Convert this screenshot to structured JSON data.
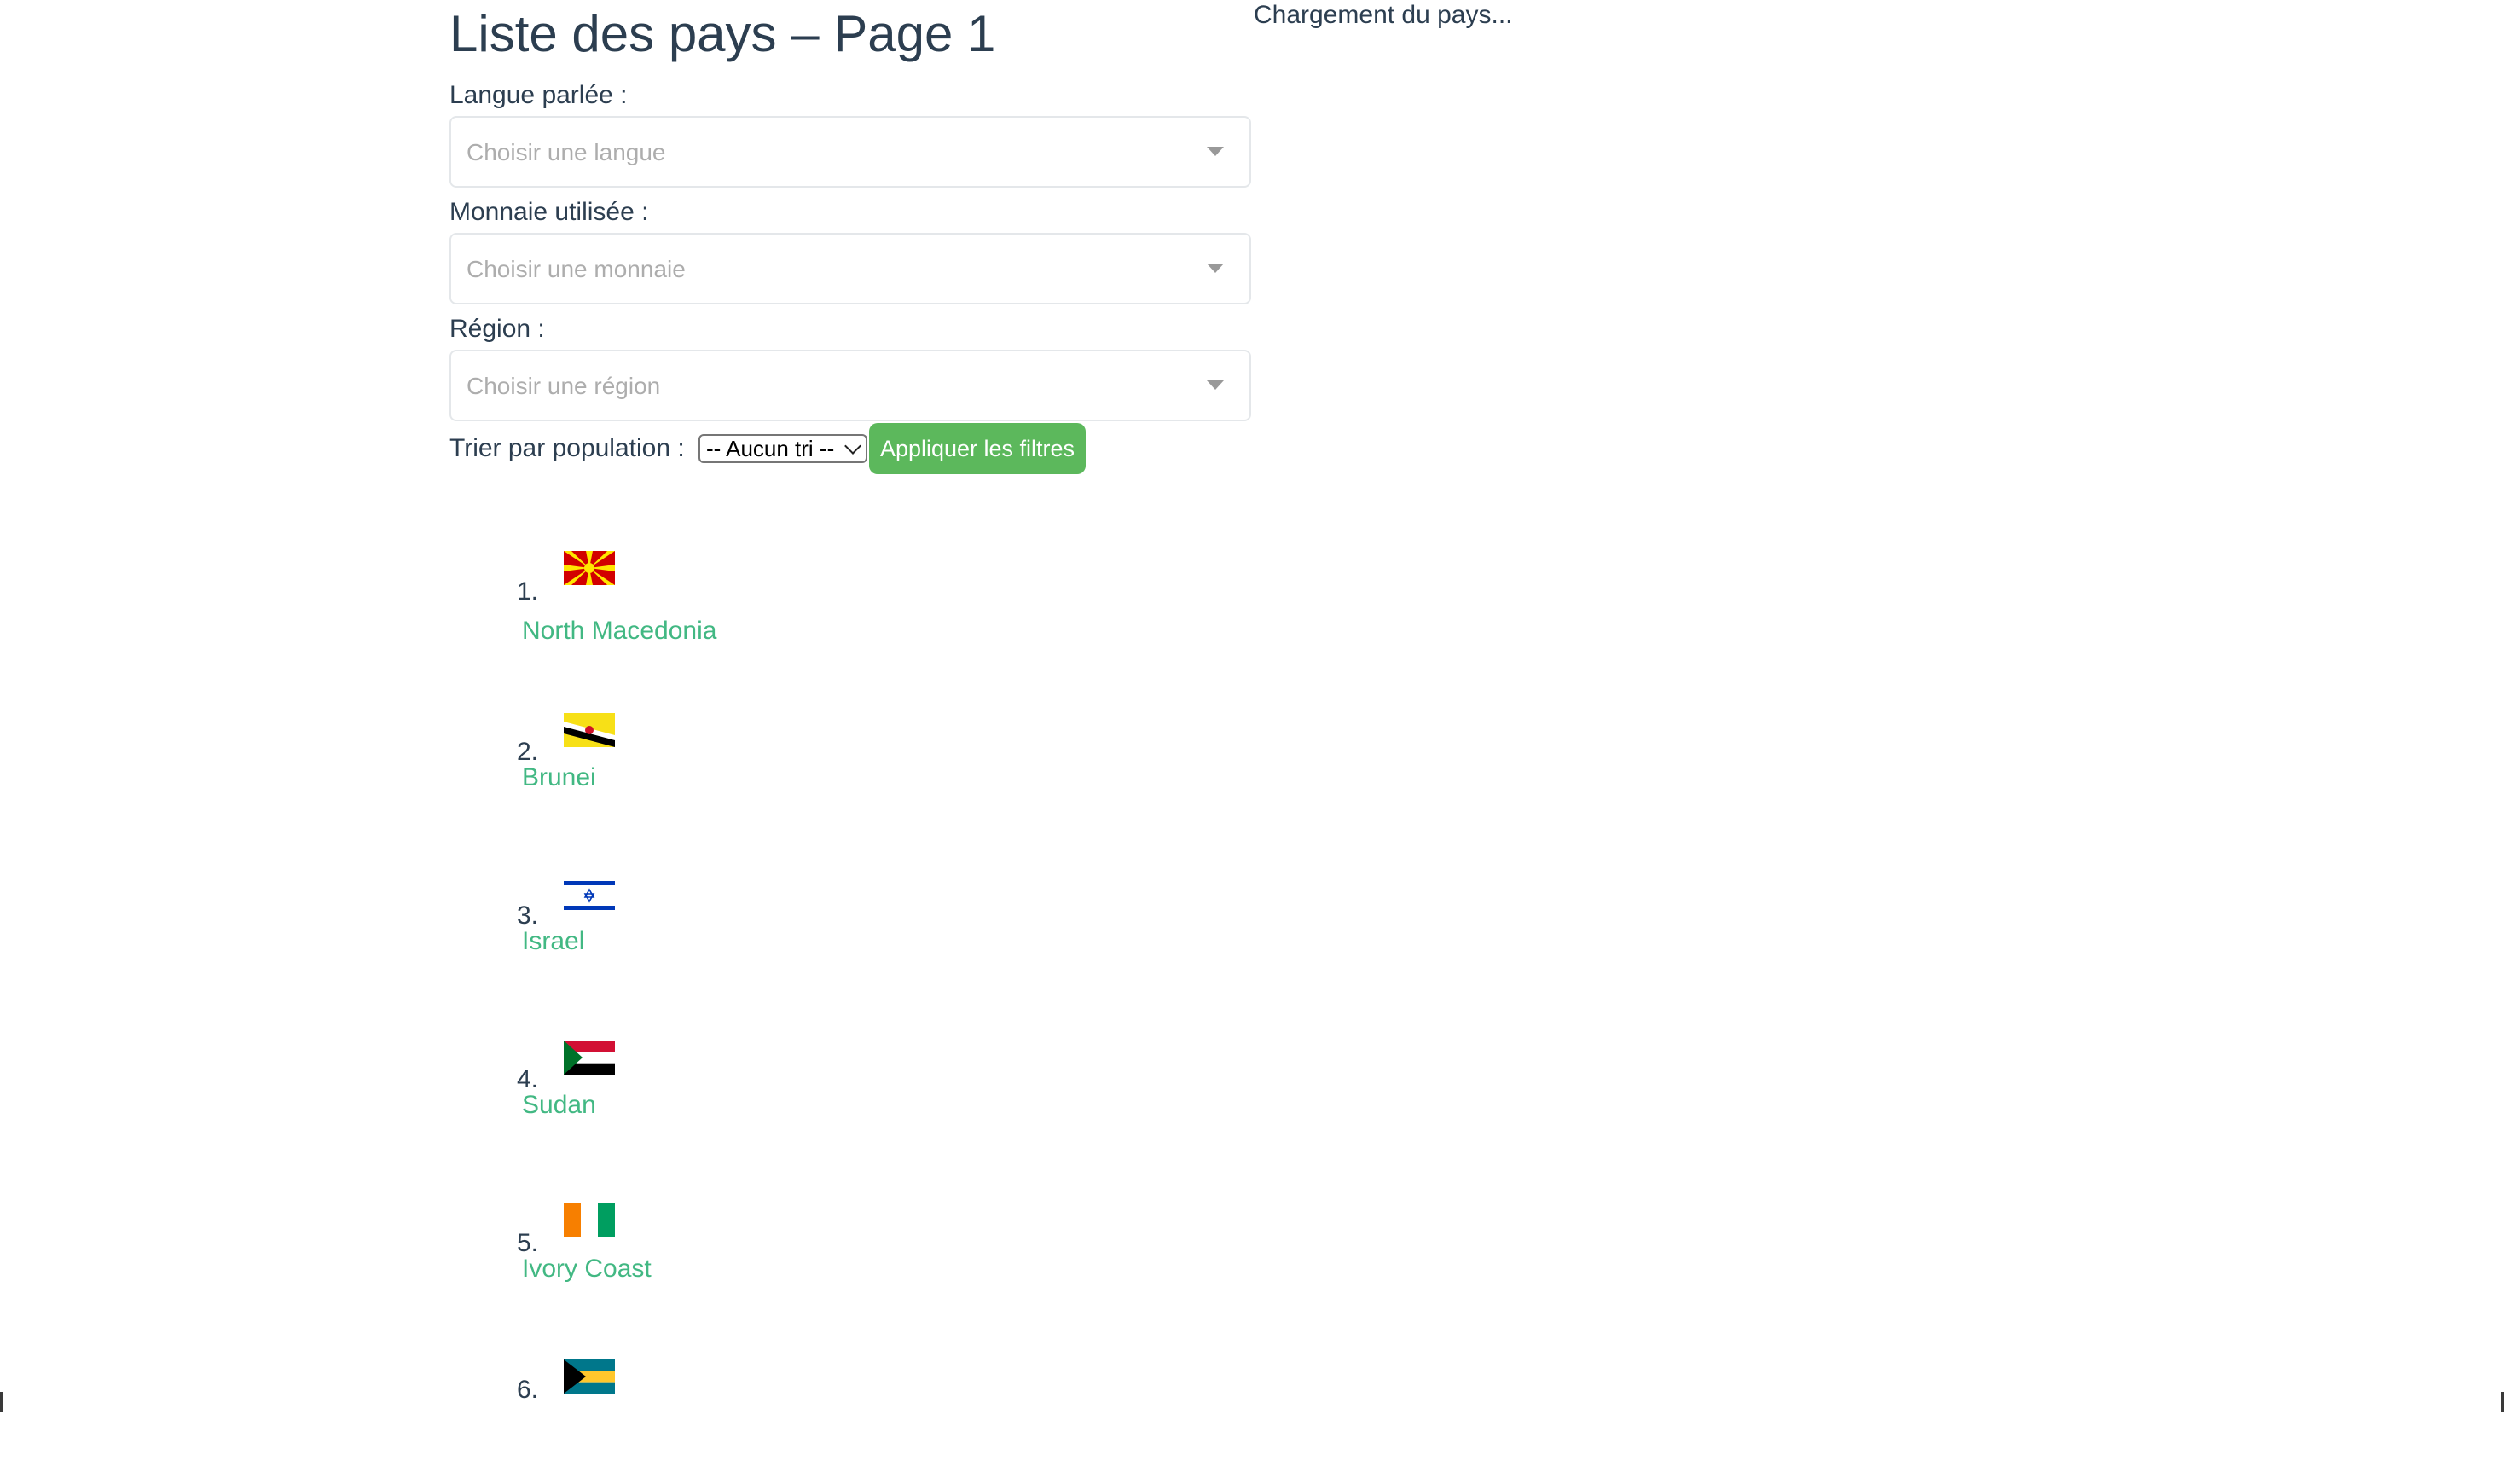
{
  "page": {
    "title": "Liste des pays – Page 1",
    "loading_text": "Chargement du pays..."
  },
  "filters": {
    "language": {
      "label": "Langue parlée :",
      "placeholder": "Choisir une langue"
    },
    "currency": {
      "label": "Monnaie utilisée :",
      "placeholder": "Choisir une monnaie"
    },
    "region": {
      "label": "Région :",
      "placeholder": "Choisir une région"
    },
    "sort": {
      "label": "Trier par population :",
      "selected": "-- Aucun tri --"
    },
    "apply_label": "Appliquer les filtres"
  },
  "countries": [
    {
      "number": "1.",
      "name": "North Macedonia",
      "flag_icon": "north-macedonia-flag"
    },
    {
      "number": "2.",
      "name": "Brunei",
      "flag_icon": "brunei-flag"
    },
    {
      "number": "3.",
      "name": "Israel",
      "flag_icon": "israel-flag"
    },
    {
      "number": "4.",
      "name": "Sudan",
      "flag_icon": "sudan-flag"
    },
    {
      "number": "5.",
      "name": "Ivory Coast",
      "flag_icon": "ivory-coast-flag"
    },
    {
      "number": "6.",
      "name": "",
      "flag_icon": "bahamas-flag"
    }
  ],
  "colors": {
    "link_green": "#42b883",
    "button_green": "#5cb85c",
    "text_dark": "#2c3e50"
  }
}
